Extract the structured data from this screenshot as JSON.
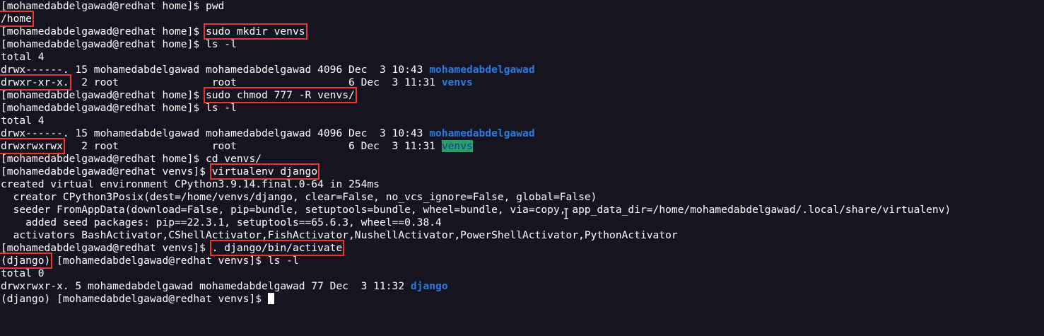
{
  "terminal": {
    "prompt_home": "[mohamedabdelgawad@redhat home]$ ",
    "prompt_venvs": "[mohamedabdelgawad@redhat venvs]$ ",
    "venv_prefix": "(django)",
    "venv_prompt_rest": " [mohamedabdelgawad@redhat venvs]$ ",
    "cmd_pwd": "pwd",
    "out_pwd": "/home",
    "cmd_mkdir": "sudo mkdir venvs",
    "cmd_ls": "ls -l",
    "total4": "total 4",
    "row1_perm": "drwx------.",
    "row1_rest": " 15 mohamedabdelgawad mohamedabdelgawad 4096 Dec  3 10:43 ",
    "row1_name": "mohamedabdelgawad",
    "row2_perm": "drwxr-xr-x.",
    "row2_rest": "  2 root               root                  6 Dec  3 11:31 ",
    "row2_name": "venvs",
    "cmd_chmod": "sudo chmod 777 -R venvs/",
    "row4_perm": "drwxrwxrwx",
    "row4_rest": "   2 root               root                  6 Dec  3 11:31 ",
    "row4_name": "venvs",
    "cmd_cd": "cd venvs/",
    "cmd_virtualenv": "virtualenv django",
    "out_created": "created virtual environment CPython3.9.14.final.0-64 in 254ms",
    "out_creator": "  creator CPython3Posix(dest=/home/venvs/django, clear=False, no_vcs_ignore=False, global=False)",
    "out_seeder": "  seeder FromAppData(download=False, pip=bundle, setuptools=bundle, wheel=bundle, via=copy, app_data_dir=/home/mohamedabdelgawad/.local/share/virtualenv)",
    "out_added": "    added seed packages: pip==22.3.1, setuptools==65.6.3, wheel==0.38.4",
    "out_activators": "  activators BashActivator,CShellActivator,FishActivator,NushellActivator,PowerShellActivator,PythonActivator",
    "cmd_activate": ". django/bin/activate",
    "total0": "total 0",
    "row5_text": "drwxrwxr-x. 5 mohamedabdelgawad mohamedabdelgawad 77 Dec  3 11:32 ",
    "row5_name": "django"
  },
  "colors": {
    "background": "#171421",
    "text": "#ffffff",
    "directory": "#2a7bde",
    "highlight_box": "#e53935",
    "writable_dir_bg": "#26a269"
  }
}
